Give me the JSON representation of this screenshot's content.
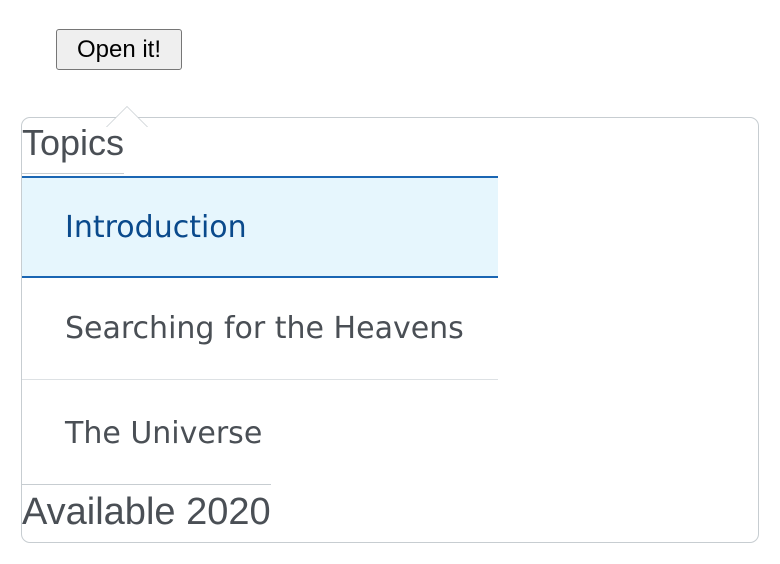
{
  "button": {
    "label": "Open it!"
  },
  "popover": {
    "sections": [
      {
        "title": "Topics",
        "items": [
          {
            "label": "Introduction",
            "selected": true
          },
          {
            "label": "Searching for the Heavens",
            "selected": false
          },
          {
            "label": "The Universe",
            "selected": false
          }
        ]
      },
      {
        "title": "Available 2020"
      }
    ]
  },
  "colors": {
    "selected_background": "#e6f6fd",
    "selected_border": "#1a66b3",
    "selected_text": "#0a4a8c",
    "text": "#4a4f55",
    "border": "#c7cdd1"
  }
}
